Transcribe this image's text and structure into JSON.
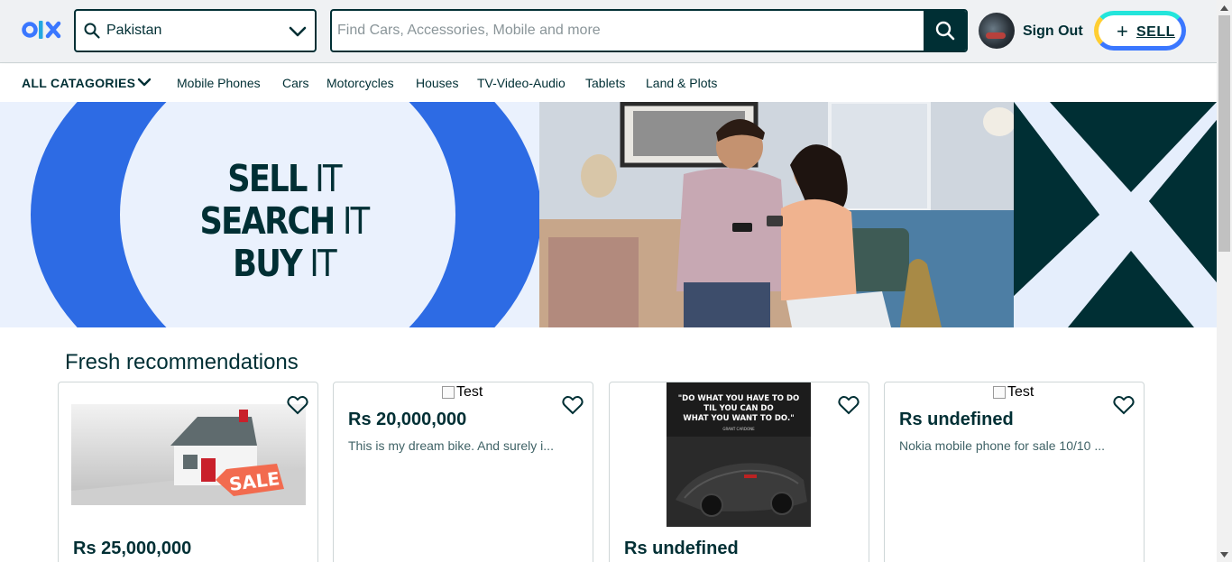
{
  "header": {
    "location_value": "Pakistan",
    "search_placeholder": "Find Cars, Accessories, Mobile and more",
    "signout_label": "Sign Out",
    "sell_label": "SELL",
    "sell_plus": "+"
  },
  "catnav": {
    "all_label": "ALL CATAGORIES",
    "items": [
      "Mobile Phones",
      "Cars",
      "Motorcycles",
      "Houses",
      "TV-Video-Audio",
      "Tablets",
      "Land & Plots"
    ]
  },
  "banner": {
    "line1_bold": "SELL",
    "line1_thin": " IT",
    "line2_bold": "SEARCH",
    "line2_thin": " IT",
    "line3_bold": "BUY",
    "line3_thin": " IT"
  },
  "recommendations": {
    "title": "Fresh recommendations",
    "cards": [
      {
        "price": "Rs 25,000,000",
        "desc": "",
        "image_alt": ""
      },
      {
        "price": "Rs 20,000,000",
        "desc": "This is my dream bike. And surely i...",
        "image_alt": "Test"
      },
      {
        "price": "Rs undefined",
        "desc": "",
        "image_alt": ""
      },
      {
        "price": "Rs undefined",
        "desc": "Nokia mobile phone for sale 10/10 ...",
        "image_alt": "Test"
      }
    ],
    "quote_lines": [
      "\"DO WHAT YOU HAVE TO DO",
      "TIL YOU CAN DO",
      "WHAT YOU WANT TO DO.\"",
      "GRANT CARDONE"
    ],
    "sale_tag": "SALE"
  },
  "colors": {
    "brand_dark": "#002f34",
    "brand_blue": "#2d6be4",
    "banner_bg": "#eaf1fd",
    "sell_border_teal": "#23e5db",
    "sell_border_blue": "#3a77ff",
    "sell_border_yellow": "#ffce32"
  },
  "icons": {
    "logo": "olx-logo",
    "location_search": "search-icon",
    "location_dropdown": "chevron-down-icon",
    "search_button": "search-icon",
    "favorite": "heart-icon"
  }
}
